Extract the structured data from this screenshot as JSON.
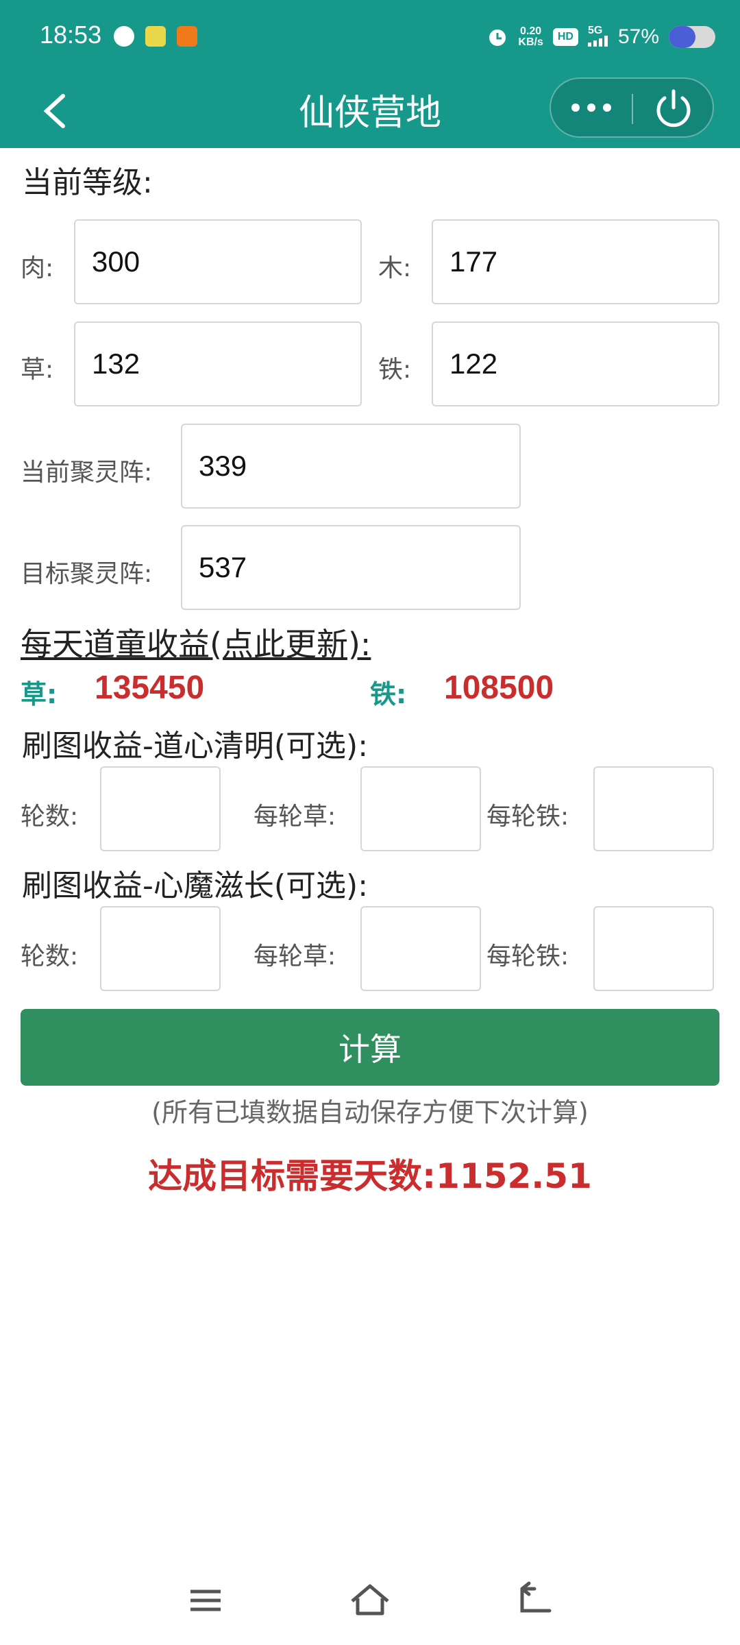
{
  "status_bar": {
    "time": "18:53",
    "net_speed_value": "0.20",
    "net_speed_unit": "KB/s",
    "hd_label": "HD",
    "signal_label": "5G",
    "battery_percent": "57%",
    "battery_level": 0.57
  },
  "header": {
    "title": "仙侠营地",
    "back_icon": "chevron-left-icon",
    "more_icon": "more-dots-icon",
    "power_icon": "power-icon"
  },
  "current_level": {
    "title": "当前等级:",
    "meat_label": "肉:",
    "meat_value": "300",
    "wood_label": "木:",
    "wood_value": "177",
    "grass_label": "草:",
    "grass_value": "132",
    "iron_label": "铁:",
    "iron_value": "122",
    "current_array_label": "当前聚灵阵:",
    "current_array_value": "339",
    "target_array_label": "目标聚灵阵:",
    "target_array_value": "537"
  },
  "daily_income": {
    "title": "每天道童收益(点此更新):",
    "grass_label": "草:",
    "grass_value": "135450",
    "iron_label": "铁:",
    "iron_value": "108500"
  },
  "map_income_1": {
    "title": "刷图收益-道心清明(可选):",
    "rounds_label": "轮数:",
    "rounds_value": "",
    "grass_per_round_label": "每轮草:",
    "grass_per_round_value": "",
    "iron_per_round_label": "每轮铁:",
    "iron_per_round_value": ""
  },
  "map_income_2": {
    "title": "刷图收益-心魔滋长(可选):",
    "rounds_label": "轮数:",
    "rounds_value": "",
    "grass_per_round_label": "每轮草:",
    "grass_per_round_value": "",
    "iron_per_round_label": "每轮铁:",
    "iron_per_round_value": ""
  },
  "actions": {
    "calculate_label": "计算",
    "autosave_note": "(所有已填数据自动保存方便下次计算)",
    "result_text": "达成目标需要天数:1152.51"
  },
  "nav_bar": {
    "menu_icon": "menu-icon",
    "home_icon": "home-icon",
    "back_icon": "back-arrow-icon"
  },
  "colors": {
    "primary": "#16998a",
    "button": "#2f8f5e",
    "highlight": "#c92d2d"
  }
}
